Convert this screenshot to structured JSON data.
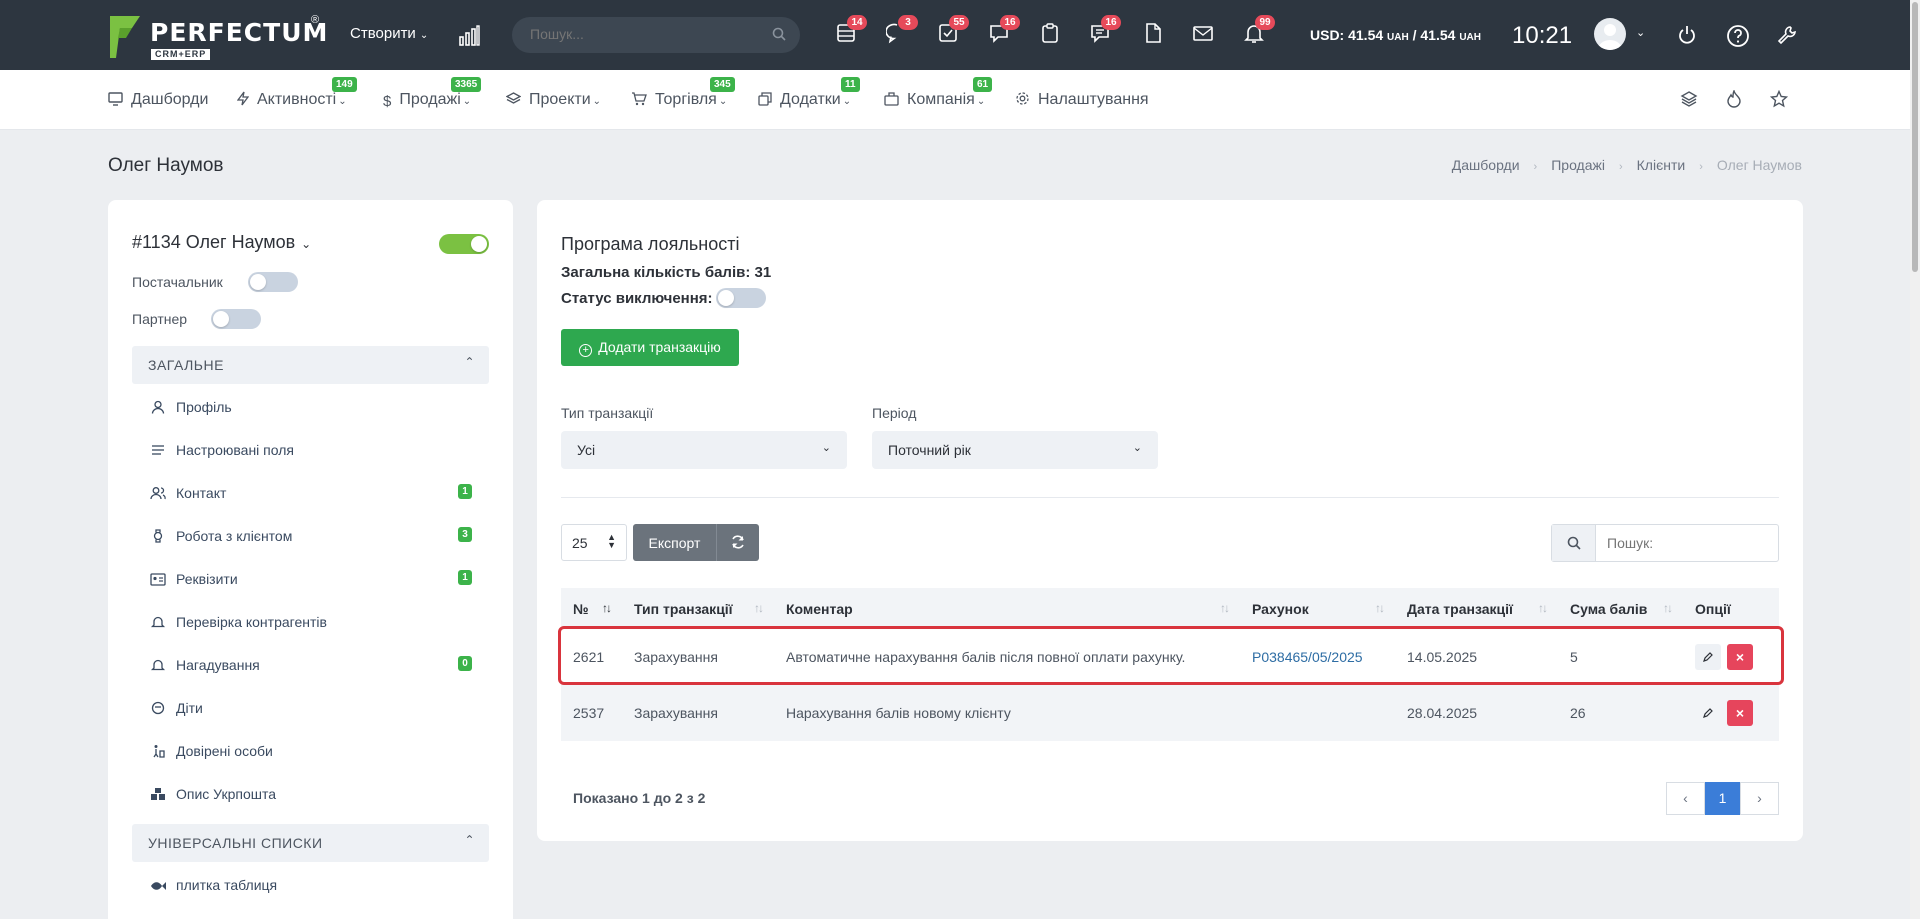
{
  "app": {
    "logo_text": "PERFECTUM",
    "logo_reg": "®",
    "logo_sub": "CRM+ERP"
  },
  "topbar": {
    "create_label": "Створити",
    "search_placeholder": "Пошук...",
    "badges": [
      "14",
      "3",
      "55",
      "16",
      "16",
      "99"
    ],
    "currency": "USD: 41.54",
    "currency_unit": "UAH",
    "currency_sep": " / 41.54 ",
    "time": "10:21"
  },
  "nav": {
    "items": [
      {
        "label": "Дашборди",
        "badge": ""
      },
      {
        "label": "Активності",
        "badge": "149"
      },
      {
        "label": "Продажі",
        "badge": "3365"
      },
      {
        "label": "Проекти",
        "badge": ""
      },
      {
        "label": "Торгівля",
        "badge": "345"
      },
      {
        "label": "Додатки",
        "badge": "11"
      },
      {
        "label": "Компанія",
        "badge": "61"
      },
      {
        "label": "Налаштування",
        "badge": ""
      }
    ]
  },
  "page": {
    "title": "Олег Наумов",
    "breadcrumb": [
      "Дашборди",
      "Продажі",
      "Клієнти",
      "Олег Наумов"
    ]
  },
  "client": {
    "name": "#1134 Олег Наумов",
    "supplier_label": "Постачальник",
    "partner_label": "Партнер",
    "general_section": "ЗАГАЛЬНЕ",
    "menu": [
      {
        "label": "Профіль",
        "count": ""
      },
      {
        "label": "Настроювані поля",
        "count": ""
      },
      {
        "label": "Контакт",
        "count": "1"
      },
      {
        "label": "Робота з клієнтом",
        "count": "3"
      },
      {
        "label": "Реквізити",
        "count": "1"
      },
      {
        "label": "Перевірка контрагентів",
        "count": ""
      },
      {
        "label": "Нагадування",
        "count": "0"
      },
      {
        "label": "Діти",
        "count": ""
      },
      {
        "label": "Довірені особи",
        "count": ""
      },
      {
        "label": "Опис Укрпошта",
        "count": ""
      }
    ],
    "lists_section": "УНІВЕРСАЛЬНІ СПИСКИ",
    "lists_item": "плитка таблиця"
  },
  "loyalty": {
    "title": "Програма лояльності",
    "total_points": "Загальна кількість балів: 31",
    "exclusion_status": "Статус виключення:",
    "add_button": "Додати транзакцію",
    "filter_type_label": "Тип транзакції",
    "filter_type_value": "Усі",
    "filter_period_label": "Період",
    "filter_period_value": "Поточний рік",
    "page_size": "25",
    "export_label": "Експорт",
    "search_placeholder": "Пошук:",
    "columns": [
      "№",
      "Тип транзакції",
      "Коментар",
      "Рахунок",
      "Дата транзакції",
      "Сума балів",
      "Опції"
    ],
    "rows": [
      {
        "id": "2621",
        "type": "Зарахування",
        "comment": "Автоматичне нарахування балів після повної оплати рахунку.",
        "invoice": "P038465/05/2025",
        "date": "14.05.2025",
        "points": "5"
      },
      {
        "id": "2537",
        "type": "Зарахування",
        "comment": "Нарахування балів новому клієнту",
        "invoice": "",
        "date": "28.04.2025",
        "points": "26"
      }
    ],
    "shown_text": "Показано 1 до 2 з 2",
    "page_current": "1"
  },
  "colors": {
    "topbar": "#2d3640",
    "accent_green": "#2ea84f",
    "delete_red": "#e6455c",
    "highlight": "#d9343d",
    "link": "#2e6da4"
  }
}
